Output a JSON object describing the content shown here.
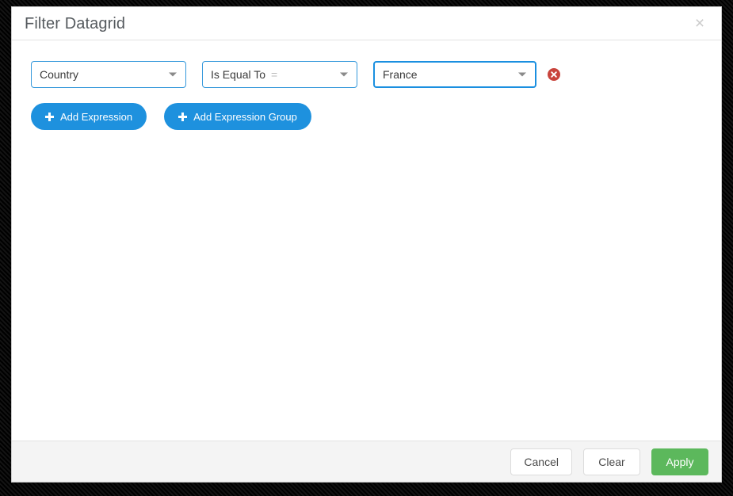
{
  "dialog": {
    "title": "Filter Datagrid",
    "close_icon": "close-icon",
    "close_label": "×"
  },
  "expressions": [
    {
      "field": {
        "value": "Country",
        "icon": "chevron-down-icon",
        "focused": false
      },
      "operator": {
        "value": "Is Equal To",
        "symbol": "=",
        "icon": "chevron-down-icon",
        "focused": false
      },
      "value": {
        "value": "France",
        "icon": "chevron-down-icon",
        "focused": true
      },
      "remove": {
        "icon": "remove-circle-icon",
        "label": ""
      }
    }
  ],
  "toolbar": {
    "add_expression_label": "Add Expression",
    "add_expression_group_label": "Add Expression Group",
    "plus_icon": "plus-icon"
  },
  "footer": {
    "cancel_label": "Cancel",
    "clear_label": "Clear",
    "apply_label": "Apply"
  },
  "colors": {
    "accent_blue": "#1e91de",
    "select_border": "#3498db",
    "select_border_focused": "#1a8fe0",
    "apply_green": "#5cb85c",
    "remove_red": "#c9443c",
    "footer_bg": "#f4f4f4",
    "title_text": "#555a5e"
  }
}
